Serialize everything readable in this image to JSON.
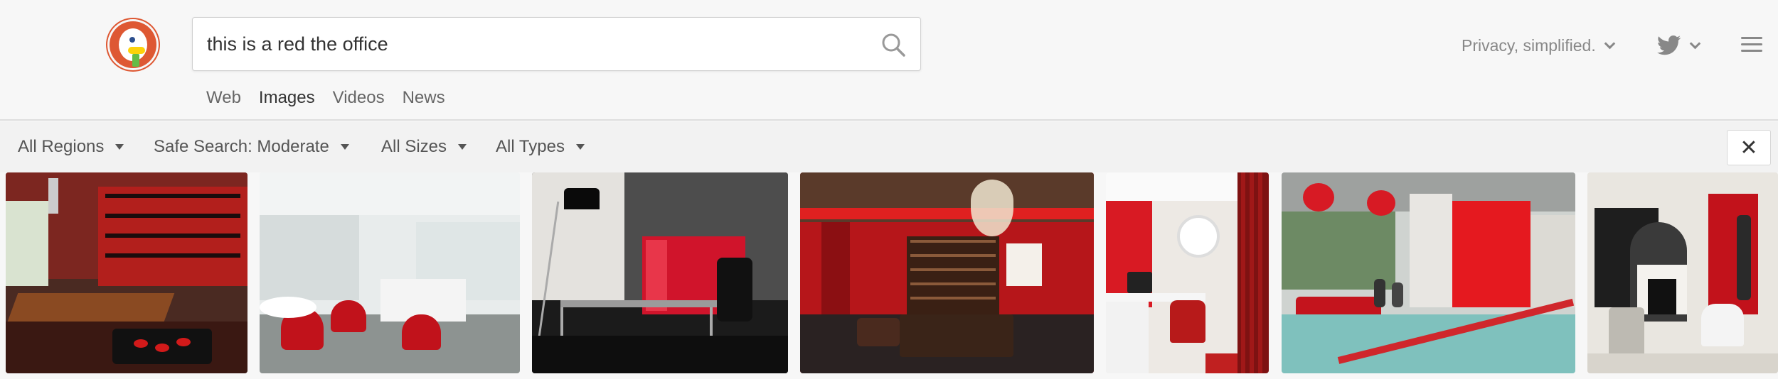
{
  "search": {
    "query": "this is a red the office"
  },
  "tabs": [
    {
      "label": "Web",
      "active": false
    },
    {
      "label": "Images",
      "active": true
    },
    {
      "label": "Videos",
      "active": false
    },
    {
      "label": "News",
      "active": false
    }
  ],
  "header": {
    "privacy_label": "Privacy, simplified."
  },
  "filters": {
    "region": "All Regions",
    "safe_search": "Safe Search: Moderate",
    "size": "All Sizes",
    "type": "All Types",
    "close_label": "✕"
  },
  "colors": {
    "brand": "#de5833",
    "accent_red": "#d8202b",
    "tab_underline": "#333333"
  },
  "icons": [
    "duckduckgo-logo",
    "search-icon",
    "chevron-down-icon",
    "twitter-icon",
    "hamburger-menu-icon",
    "caret-down-icon",
    "close-icon"
  ],
  "images": [
    {
      "name": "image-result-1",
      "theme": "red wall office with shelves and wooden desk"
    },
    {
      "name": "image-result-2",
      "theme": "white office with red chairs"
    },
    {
      "name": "image-result-3",
      "theme": "glass desk with red cabinets and arc lamp"
    },
    {
      "name": "image-result-4",
      "theme": "red library room with chandelier"
    },
    {
      "name": "image-result-5",
      "theme": "white desk with red chair and curtains"
    },
    {
      "name": "image-result-6",
      "theme": "open office with red lounge and pendant lamps"
    },
    {
      "name": "image-result-7",
      "theme": "dark room with fireplace and red door"
    }
  ]
}
